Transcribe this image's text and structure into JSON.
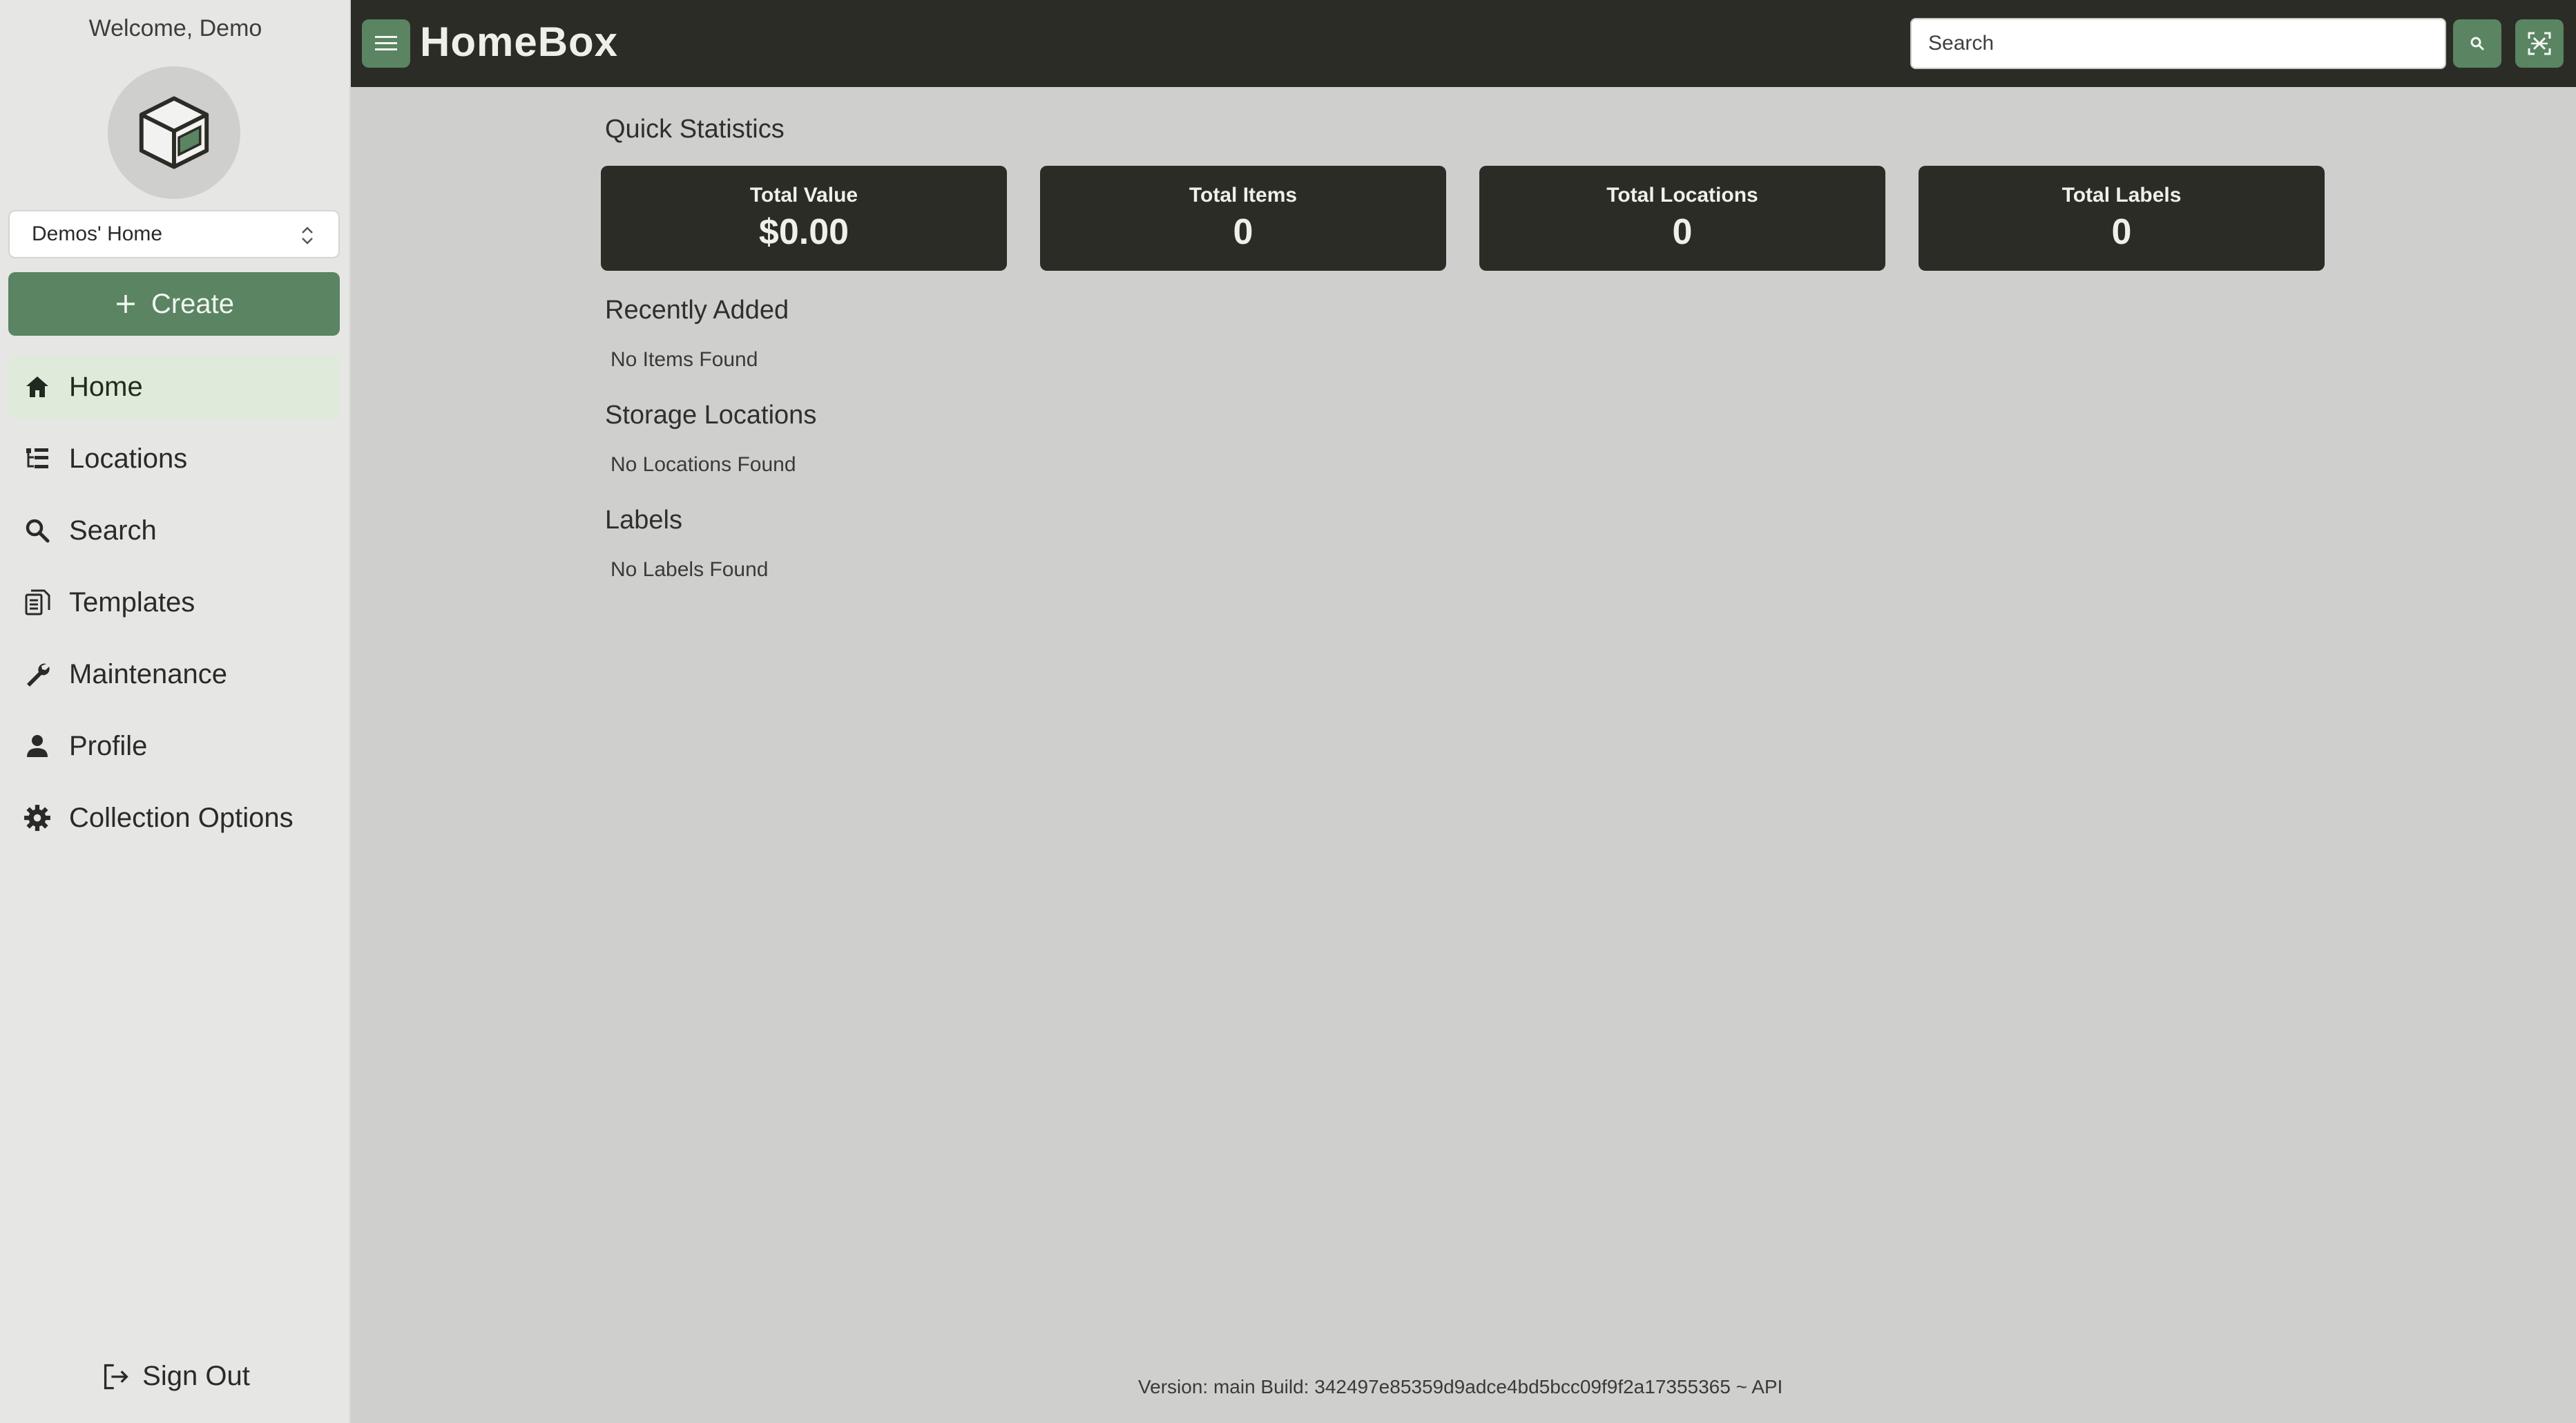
{
  "sidebar": {
    "welcome": "Welcome, Demo",
    "collection": "Demos' Home",
    "create_label": "Create",
    "items": [
      {
        "label": "Home",
        "icon": "home-icon"
      },
      {
        "label": "Locations",
        "icon": "tree-icon"
      },
      {
        "label": "Search",
        "icon": "search-icon"
      },
      {
        "label": "Templates",
        "icon": "document-icon"
      },
      {
        "label": "Maintenance",
        "icon": "wrench-icon"
      },
      {
        "label": "Profile",
        "icon": "user-icon"
      },
      {
        "label": "Collection Options",
        "icon": "gear-icon"
      }
    ],
    "active_item": "Home",
    "sign_out": "Sign Out"
  },
  "header": {
    "brand": "HomeBox",
    "search_placeholder": "Search"
  },
  "main": {
    "quick_stats_title": "Quick Statistics",
    "stats": [
      {
        "label": "Total Value",
        "value": "$0.00"
      },
      {
        "label": "Total Items",
        "value": "0"
      },
      {
        "label": "Total Locations",
        "value": "0"
      },
      {
        "label": "Total Labels",
        "value": "0"
      }
    ],
    "recently_added_title": "Recently Added",
    "recently_added_empty": "No Items Found",
    "storage_locations_title": "Storage Locations",
    "storage_locations_empty": "No Locations Found",
    "labels_title": "Labels",
    "labels_empty": "No Labels Found"
  },
  "footer": {
    "version": "Version: main Build: 342497e85359d9adce4bd5bcc09f9f2a17355365 ~ API"
  },
  "colors": {
    "accent": "#5a8462",
    "dark": "#2b2c26",
    "active_nav": "#dfeadb"
  }
}
